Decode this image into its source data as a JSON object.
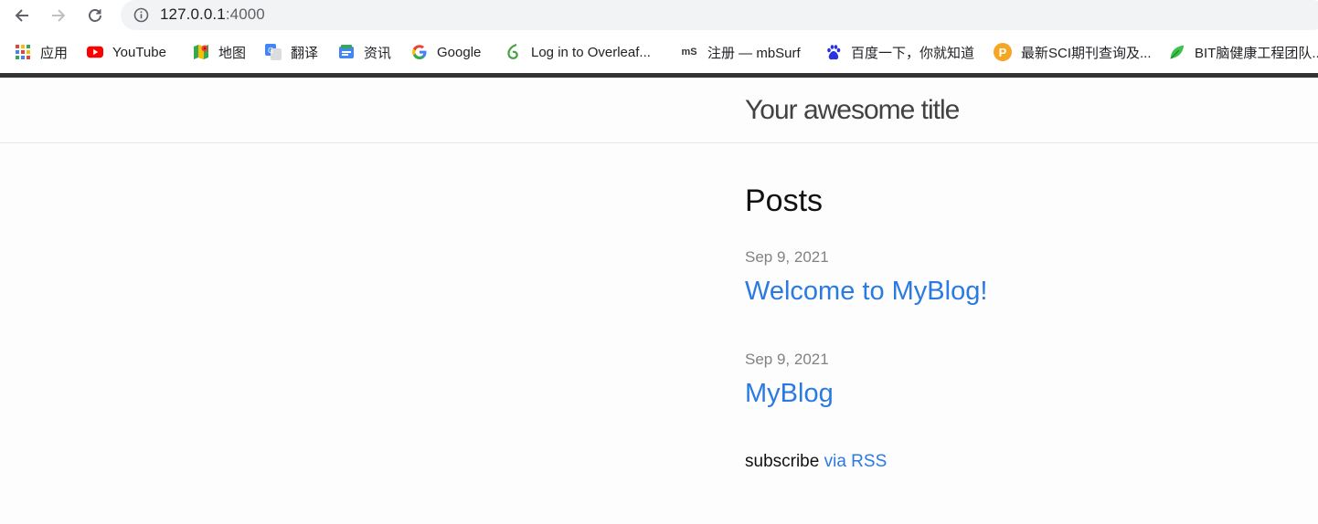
{
  "browser": {
    "url_host": "127.0.0.1",
    "url_port": ":4000",
    "bookmarks": [
      {
        "label": "应用",
        "icon": "apps-grid-icon"
      },
      {
        "label": "YouTube",
        "icon": "youtube-icon"
      },
      {
        "label": "地图",
        "icon": "maps-icon"
      },
      {
        "label": "翻译",
        "icon": "translate-icon"
      },
      {
        "label": "资讯",
        "icon": "news-icon"
      },
      {
        "label": "Google",
        "icon": "google-icon"
      },
      {
        "label": "Log in to Overleaf...",
        "icon": "overleaf-icon"
      },
      {
        "label": "注册 — mbSurf",
        "icon": "mbsurf-icon"
      },
      {
        "label": "百度一下，你就知道",
        "icon": "baidu-icon"
      },
      {
        "label": "最新SCI期刊查询及...",
        "icon": "p-badge-icon"
      },
      {
        "label": "BIT脑健康工程团队...",
        "icon": "leaf-icon"
      }
    ],
    "mbsurf_icon_text": "mS",
    "p_badge_text": "P"
  },
  "site": {
    "title": "Your awesome title"
  },
  "main": {
    "heading": "Posts",
    "posts": [
      {
        "date": "Sep 9, 2021",
        "title": "Welcome to MyBlog!"
      },
      {
        "date": "Sep 9, 2021",
        "title": "MyBlog"
      }
    ],
    "subscribe_text": "subscribe",
    "rss_link": "via RSS"
  },
  "colors": {
    "link": "#2a7ae2",
    "meta": "#828282",
    "topbar": "#333333"
  }
}
